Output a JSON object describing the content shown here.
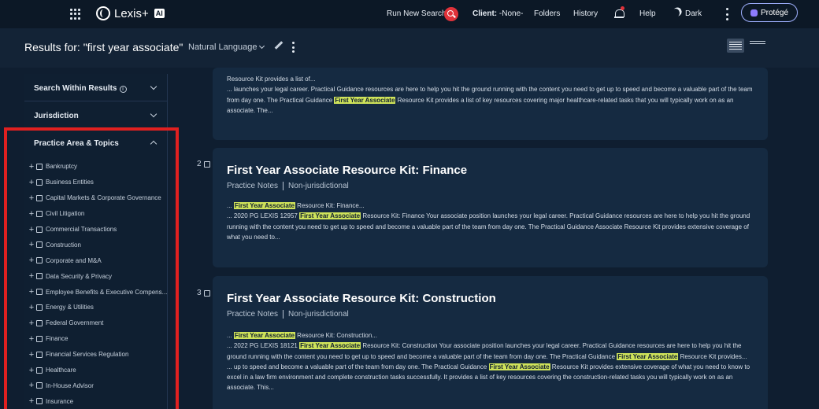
{
  "topnav": {
    "logo_text": "Lexis+",
    "logo_badge": "AI",
    "run_new_search": "Run New Search",
    "client_label": "Client:",
    "client_value": "-None-",
    "folders": "Folders",
    "history": "History",
    "help": "Help",
    "theme": "Dark",
    "protege": "Protégé"
  },
  "results_bar": {
    "title": "Results for: \"first year associate\"",
    "search_mode": "Natural Language"
  },
  "sidebar": {
    "filters": [
      {
        "label": "Search Within Results"
      },
      {
        "label": "Jurisdiction"
      },
      {
        "label": "Practice Area & Topics"
      }
    ],
    "practice_areas": [
      "Bankruptcy",
      "Business Entities",
      "Capital Markets & Corporate Governance",
      "Civil Litigation",
      "Commercial Transactions",
      "Construction",
      "Corporate and M&A",
      "Data Security & Privacy",
      "Employee Benefits & Executive Compens...",
      "Energy & Utilities",
      "Federal Government",
      "Finance",
      "Financial Services Regulation",
      "Healthcare",
      "In-House Advisor",
      "Insurance"
    ]
  },
  "results": {
    "card1": {
      "line1": "Resource Kit provides a list of...",
      "line2a": "... launches your legal career. Practical Guidance resources are here to help you hit the ground running with the content you need to get up to speed and become a valuable part of the team from day one. The Practical Guidance ",
      "hl": "First Year Associate",
      "line2b": " Resource Kit provides a list of key resources covering major healthcare-related tasks that you will typically work on as an associate. The..."
    },
    "card2": {
      "number": "2",
      "title": "First Year Associate Resource Kit: Finance",
      "type": "Practice Notes",
      "jurisdiction": "Non-jurisdictional",
      "hl": "First Year Associate",
      "s1b": " Resource Kit: Finance...",
      "s2a": "... 2020 PG LEXIS 12957 ",
      "s2b": " Resource Kit: Finance Your associate position launches your legal career. Practical Guidance resources are here to help you hit the ground running with the content you need to get up to speed and become a valuable part of the team from day one. The Practical Guidance Associate Resource Kit provides extensive coverage of what you need to..."
    },
    "card3": {
      "number": "3",
      "title": "First Year Associate Resource Kit: Construction",
      "type": "Practice Notes",
      "jurisdiction": "Non-jurisdictional",
      "hl": "First Year Associate",
      "s1b": " Resource Kit: Construction...",
      "s2a": "... 2022 PG LEXIS 18121 ",
      "s2b": " Resource Kit: Construction Your associate position launches your legal career. Practical Guidance resources are here to help you hit the ground running with the content you need to get up to speed and become a valuable part of the team from day one. The Practical Guidance ",
      "s2c": " Resource Kit provides...",
      "s3a": "... up to speed and become a valuable part of the team from day one. The Practical Guidance ",
      "s3b": " Resource Kit provides extensive coverage of what you need to know to excel in a law firm environment and complete construction tasks successfully. It provides a list of key resources covering the construction-related tasks you will typically work on as an associate. This..."
    }
  }
}
